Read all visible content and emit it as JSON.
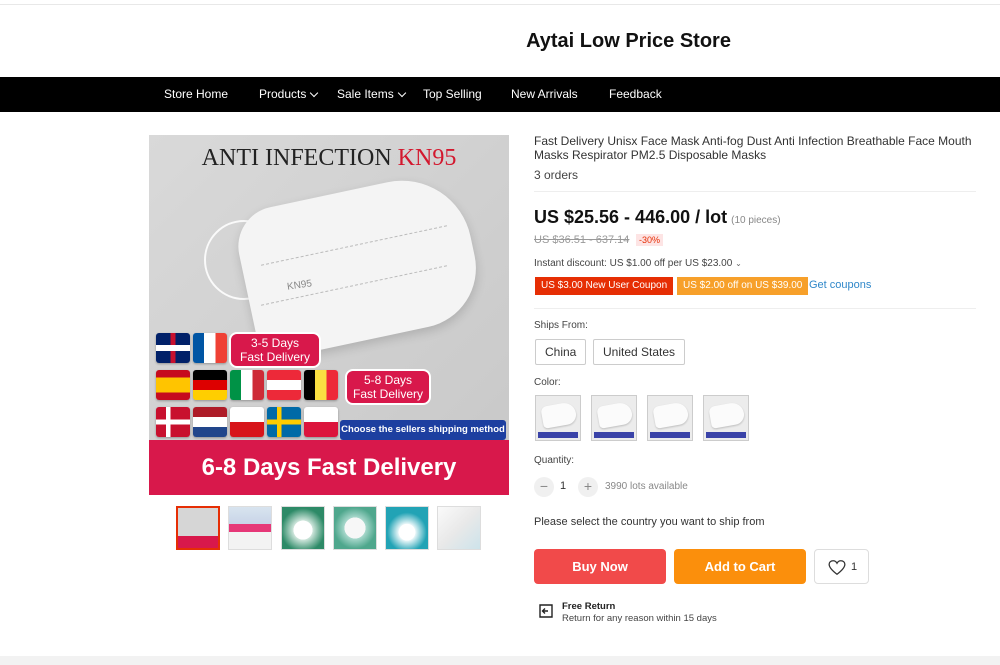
{
  "store": {
    "name": "Aytai Low Price Store"
  },
  "nav": {
    "items": [
      {
        "label": "Store Home",
        "dropdown": false
      },
      {
        "label": "Products",
        "dropdown": true
      },
      {
        "label": "Sale Items",
        "dropdown": true
      },
      {
        "label": "Top Selling",
        "dropdown": false
      },
      {
        "label": "New Arrivals",
        "dropdown": false
      },
      {
        "label": "Feedback",
        "dropdown": false
      }
    ]
  },
  "gallery": {
    "main": {
      "heading_black": "ANTI INFECTION",
      "heading_red": "KN95",
      "mask_text": "KN95",
      "badge1_line1": "3-5 Days",
      "badge1_line2": "Fast Delivery",
      "badge2_line1": "5-8 Days",
      "badge2_line2": "Fast Delivery",
      "ship_method": "Choose the sellers shipping method",
      "delivery_banner": "6-8 Days Fast Delivery"
    }
  },
  "product": {
    "title": "Fast Delivery Unisx Face Mask Anti-fog Dust Anti Infection Breathable Face Mouth Masks Respirator PM2.5 Disposable Masks",
    "orders": "3 orders",
    "price": "US $25.56 - 446.00 / lot",
    "price_unit": "(10 pieces)",
    "old_price": "US $36.51 - 637.14",
    "discount": "-30%",
    "instant_discount": "Instant discount: US $1.00 off per US $23.00",
    "coupons": [
      "US $3.00 New User Coupon",
      "US $2.00 off on US $39.00"
    ],
    "get_coupons": "Get coupons",
    "ships_from_label": "Ships From:",
    "ships_from": [
      "China",
      "United States"
    ],
    "color_label": "Color:",
    "quantity_label": "Quantity:",
    "quantity": "1",
    "available": "3990 lots available",
    "ship_message": "Please select the country you want to ship from",
    "buy_now": "Buy Now",
    "add_to_cart": "Add to Cart",
    "wishlist_count": "1",
    "return_title": "Free Return",
    "return_desc": "Return for any reason within 15 days"
  },
  "colors": {
    "accent": "#e62e04",
    "buy": "#f14a4a",
    "cart": "#fb8f0c",
    "banner": "#d8184b",
    "link": "#2f87c9"
  }
}
